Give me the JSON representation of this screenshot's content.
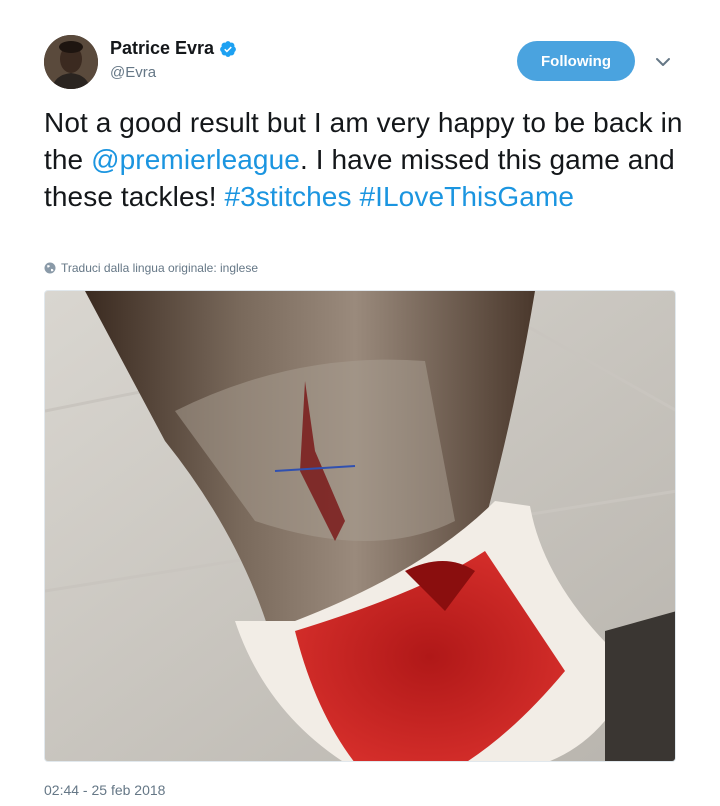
{
  "tweet": {
    "display_name": "Patrice Evra",
    "handle": "@Evra",
    "verified": true,
    "follow_label": "Following",
    "text_parts": {
      "p1": "Not a good result but I am very happy to be back in the ",
      "mention": "@premierleague",
      "p2": ". I have missed this game and these tackles! ",
      "hashtag1": "#3stitches",
      "p3": " ",
      "hashtag2": "#ILoveThisGame"
    },
    "translate_label": "Traduci dalla lingua originale: inglese",
    "timestamp": "02:44 - 25 feb 2018"
  },
  "colors": {
    "link": "#1b95e0",
    "follow_button": "#4aa3df",
    "secondary_text": "#657786",
    "primary_text": "#14171a"
  },
  "icons": [
    "verified-badge-icon",
    "chevron-down-icon",
    "globe-icon"
  ]
}
